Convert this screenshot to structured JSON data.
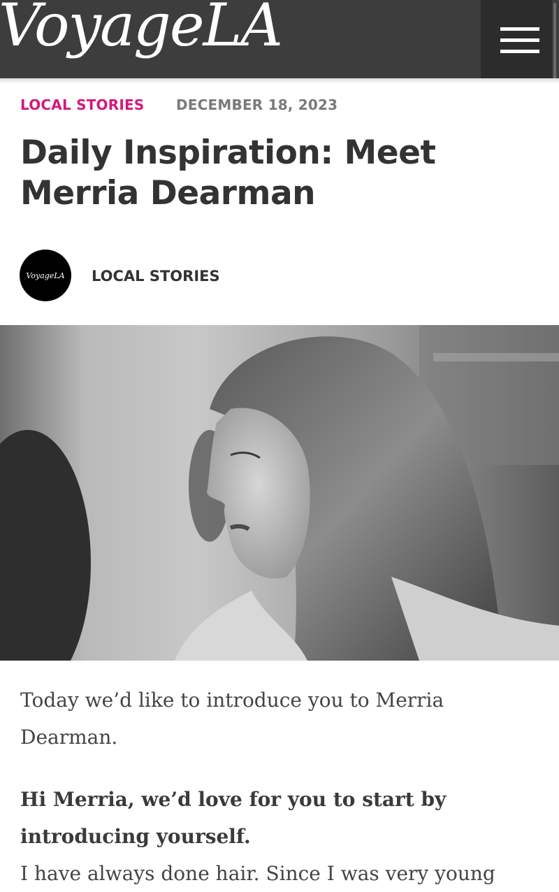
{
  "header": {
    "logo": "VoyageLA",
    "menu_icon": "hamburger-menu-icon"
  },
  "article": {
    "category": "LOCAL STORIES",
    "date": "DECEMBER 18, 2023",
    "title": "Daily Inspiration: Meet Merria Dearman",
    "author_avatar_text": "VoyageLA",
    "author": "LOCAL STORIES",
    "intro": "Today we’d like to introduce you to Merria Dearman.",
    "question1": "Hi Merria, we’d love for you to start by introducing yourself.",
    "answer1_start": "I have always done hair. Since I was very young"
  },
  "colors": {
    "header_bg": "#3d3d3d",
    "accent": "#d4187d",
    "title": "#333333"
  }
}
